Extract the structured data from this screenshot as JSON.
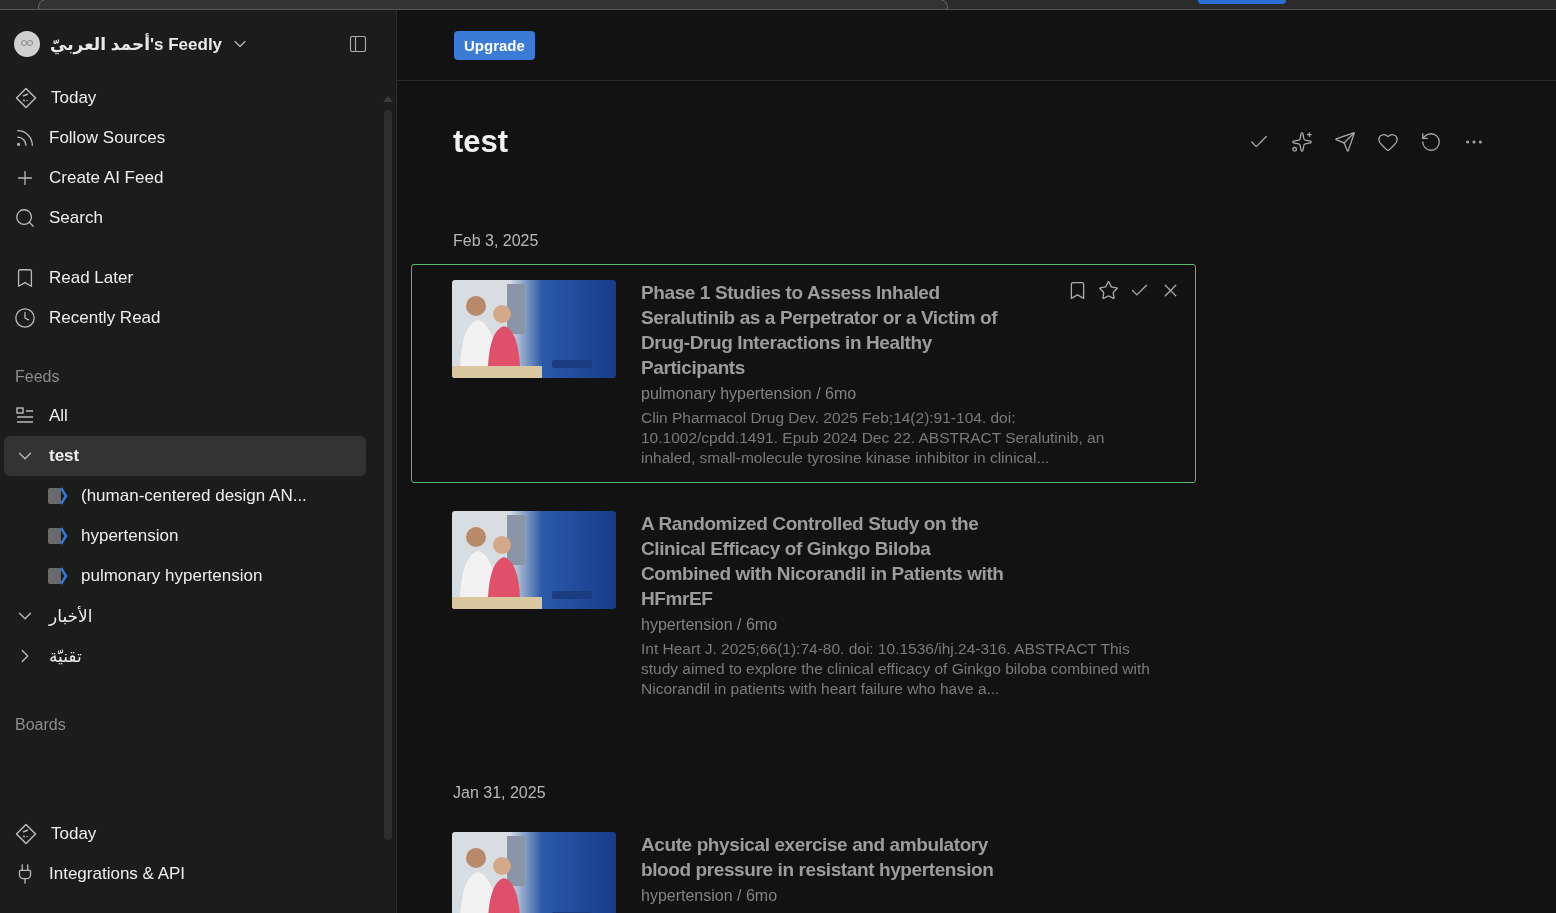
{
  "sidebar": {
    "account": "أحمد العربيّ's Feedly",
    "nav": [
      {
        "label": "Today"
      },
      {
        "label": "Follow Sources"
      },
      {
        "label": "Create AI Feed"
      },
      {
        "label": "Search"
      }
    ],
    "library": [
      {
        "label": "Read Later"
      },
      {
        "label": "Recently Read"
      }
    ],
    "feeds_heading": "Feeds",
    "feeds": [
      {
        "label": "All",
        "kind": "all",
        "selected": false
      },
      {
        "label": "test",
        "kind": "folder",
        "expanded": true,
        "selected": true,
        "children": [
          {
            "label": "(human-centered design AN...",
            "kind": "source",
            "selected": false
          },
          {
            "label": "hypertension",
            "kind": "source",
            "selected": false
          },
          {
            "label": "pulmonary hypertension",
            "kind": "source",
            "selected": false
          }
        ]
      },
      {
        "label": "الأخبار",
        "kind": "folder",
        "expanded": true,
        "selected": false
      },
      {
        "label": "تقنيّة",
        "kind": "folder",
        "expanded": false,
        "selected": false
      }
    ],
    "boards_heading": "Boards",
    "footer": [
      {
        "label": "Today"
      },
      {
        "label": "Integrations & API"
      }
    ]
  },
  "header": {
    "upgrade": "Upgrade"
  },
  "feed": {
    "title": "test",
    "groups": [
      {
        "date": "Feb 3, 2025",
        "articles": [
          {
            "title": "Phase 1 Studies to Assess Inhaled Seralutinib as a Perpetrator or a Victim of Drug-Drug Interactions in Healthy Participants",
            "meta": "pulmonary hypertension / 6mo",
            "summary": "Clin Pharmacol Drug Dev. 2025 Feb;14(2):91-104. doi: 10.1002/cpdd.1491. Epub 2024 Dec 22. ABSTRACT Seralutinib, an inhaled, small-molecule tyrosine kinase inhibitor in clinical...",
            "selected": true
          },
          {
            "title": "A Randomized Controlled Study on the Clinical Efficacy of Ginkgo Biloba Combined with Nicorandil in Patients with HFmrEF",
            "meta": "hypertension / 6mo",
            "summary": "Int Heart J. 2025;66(1):74-80. doi: 10.1536/ihj.24-316. ABSTRACT This study aimed to explore the clinical efficacy of Ginkgo biloba combined with Nicorandil in patients with heart failure who have a...",
            "selected": false
          }
        ]
      },
      {
        "date": "Jan 31, 2025",
        "articles": [
          {
            "title": "Acute physical exercise and ambulatory blood pressure in resistant hypertension",
            "meta": "hypertension / 6mo",
            "selected": false
          }
        ]
      }
    ]
  }
}
